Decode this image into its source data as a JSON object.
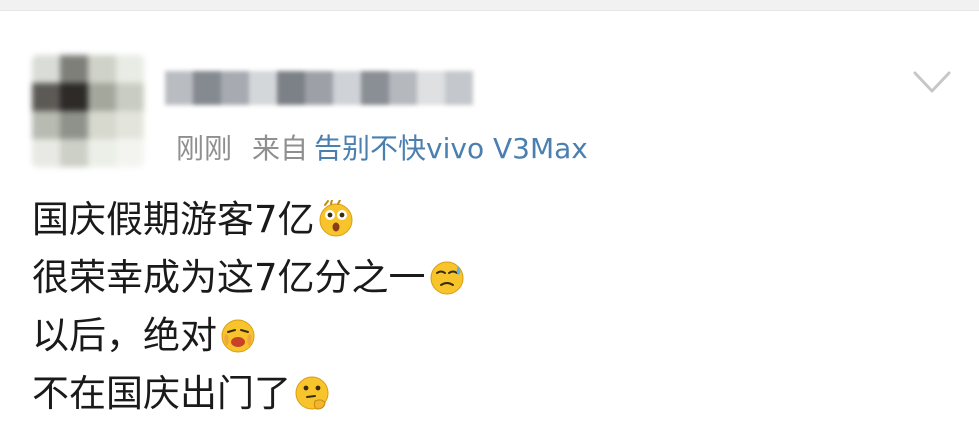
{
  "post": {
    "time": "刚刚",
    "from_label": "来自",
    "source": "告别不快vivo V3Max",
    "lines": [
      {
        "text": "国庆假期游客7亿",
        "emoji": "astonished-face-icon"
      },
      {
        "text": "很荣幸成为这7亿分之一",
        "emoji": "sad-sweat-face-icon"
      },
      {
        "text": "以后，绝对",
        "emoji": "crying-face-icon"
      },
      {
        "text": "不在国庆出门了",
        "emoji": "thinking-face-icon"
      }
    ]
  },
  "colors": {
    "link": "#4a7fb0",
    "muted": "#8f8f8f",
    "text": "#1a1a1a",
    "emoji_yellow": "#f7c52b"
  }
}
